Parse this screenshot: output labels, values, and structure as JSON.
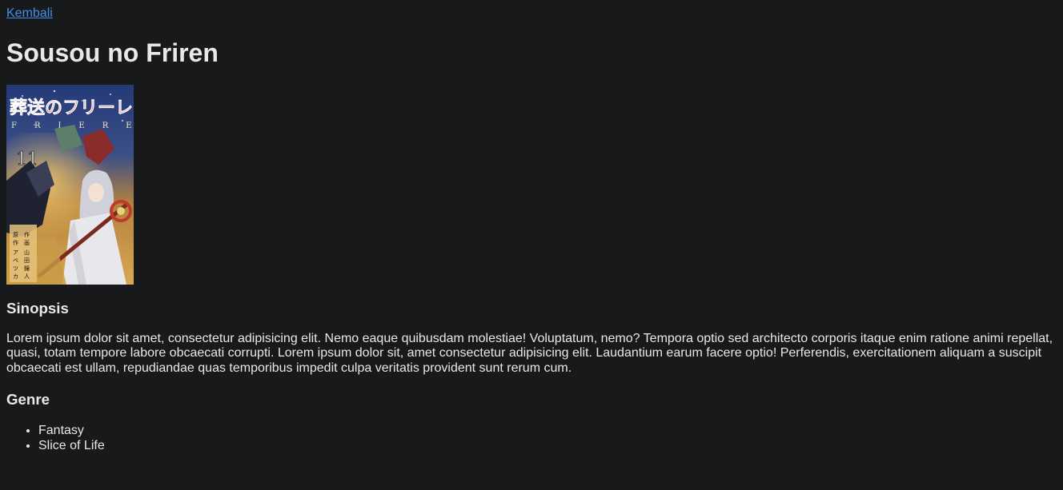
{
  "nav": {
    "back_label": "Kembali"
  },
  "title": "Sousou no Friren",
  "cover": {
    "title_jp": "葬送のフリーレン",
    "volume": "11",
    "colors": {
      "sky": "#2b3f7a",
      "gold": "#d7a54a",
      "robe": "#e6e6e9",
      "hair": "#c9c9d3",
      "title": "#c21f4b"
    }
  },
  "synopsis": {
    "heading": "Sinopsis",
    "text": "Lorem ipsum dolor sit amet, consectetur adipisicing elit. Nemo eaque quibusdam molestiae! Voluptatum, nemo? Tempora optio sed architecto corporis itaque enim ratione animi repellat, quasi, totam tempore labore obcaecati corrupti. Lorem ipsum dolor sit, amet consectetur adipisicing elit. Laudantium earum facere optio! Perferendis, exercitationem aliquam a suscipit obcaecati est ullam, repudiandae quas temporibus impedit culpa veritatis provident sunt rerum cum."
  },
  "genre": {
    "heading": "Genre",
    "items": [
      "Fantasy",
      "Slice of Life"
    ]
  }
}
